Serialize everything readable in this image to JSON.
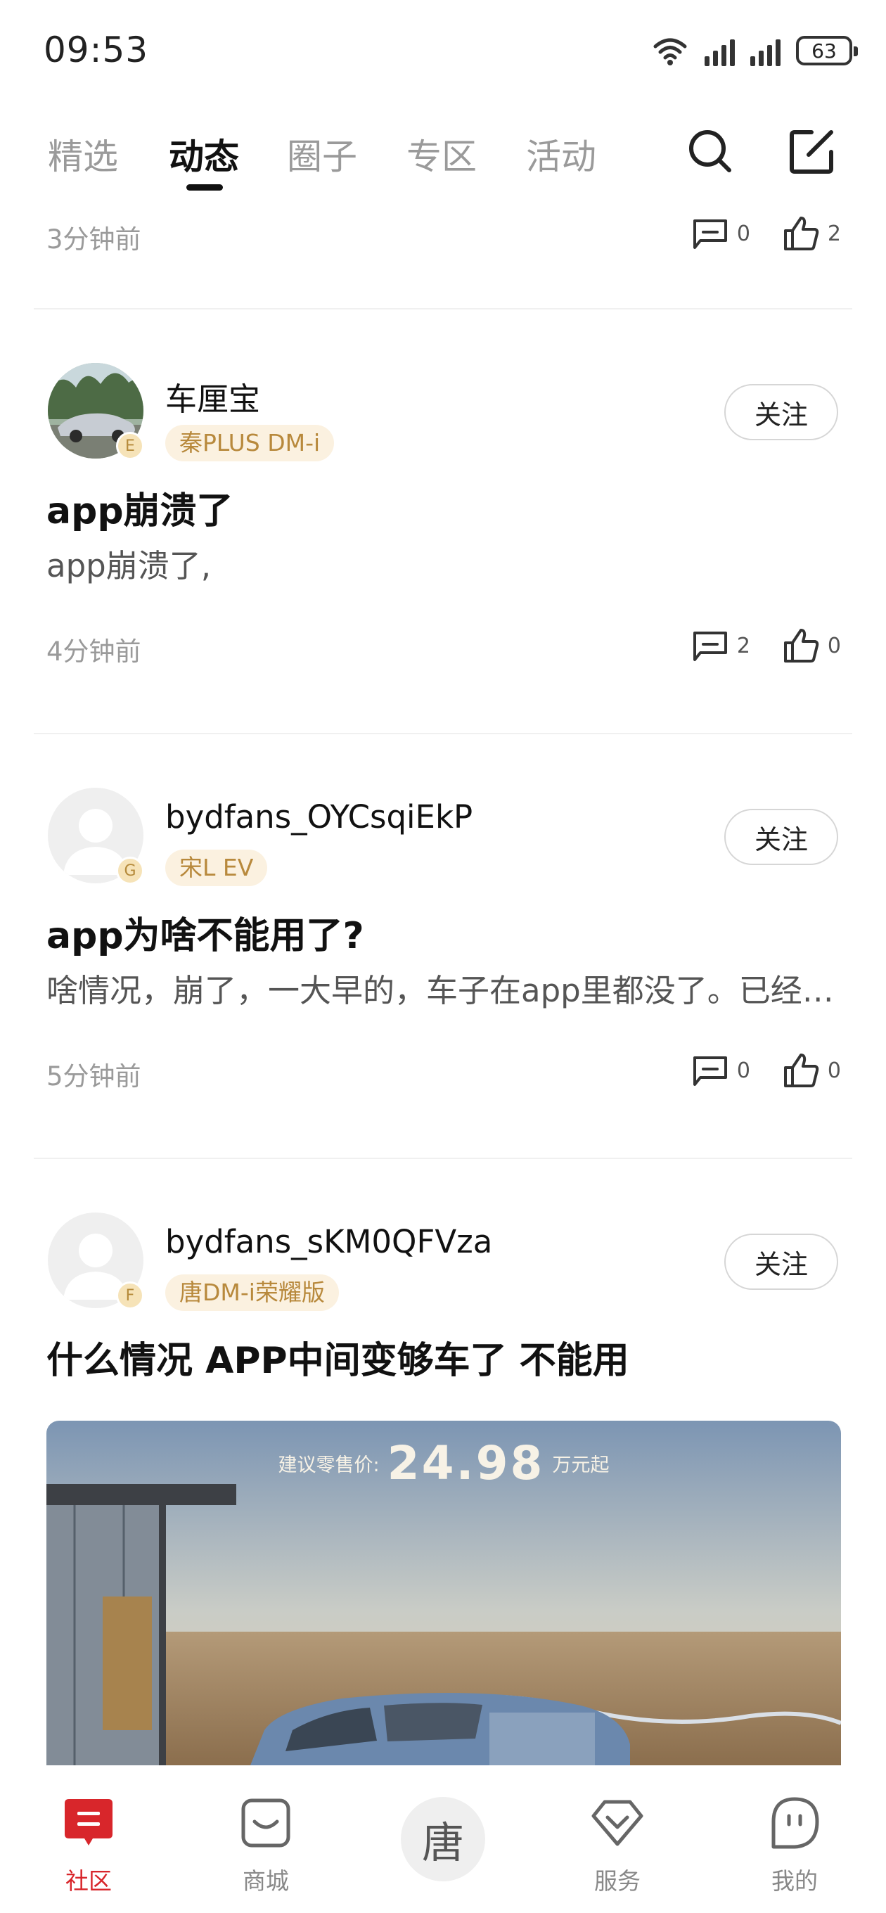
{
  "status_bar": {
    "time": "09:53",
    "battery": "63"
  },
  "tabs": [
    {
      "label": "精选",
      "active": false
    },
    {
      "label": "动态",
      "active": true
    },
    {
      "label": "圈子",
      "active": false
    },
    {
      "label": "专区",
      "active": false
    },
    {
      "label": "活动",
      "active": false
    }
  ],
  "top_actions": {
    "search_icon": "search-icon",
    "compose_icon": "edit-icon"
  },
  "previous_post_meta": {
    "time": "3分钟前",
    "comments": "0",
    "likes": "2"
  },
  "posts": [
    {
      "username": "车厘宝",
      "level": "E",
      "car_tag": "秦PLUS DM-i",
      "follow_label": "关注",
      "title": "app崩溃了",
      "body": "app崩溃了,",
      "time": "4分钟前",
      "comments": "2",
      "likes": "0"
    },
    {
      "username": "bydfans_OYCsqiEkP",
      "level": "G",
      "car_tag": "宋L EV",
      "follow_label": "关注",
      "title": "app为啥不能用了?",
      "body": "啥情况，崩了，一大早的，车子在app里都没了。已经连续好几天了，还是没有恢复正常使用",
      "time": "5分钟前",
      "comments": "0",
      "likes": "0"
    },
    {
      "username": "bydfans_sKM0QFVza",
      "level": "F",
      "car_tag": "唐DM-i荣耀版",
      "follow_label": "关注",
      "title": "什么情况  APP中间变够车了  不能用",
      "image": {
        "price_label": "建议零售价:",
        "price_value": "24.98",
        "price_unit": "万元起"
      }
    }
  ],
  "bottom_nav": {
    "items": [
      {
        "label": "社区",
        "icon": "community-icon",
        "active": true
      },
      {
        "label": "商城",
        "icon": "mall-bag-icon",
        "active": false
      },
      {
        "label": "服务",
        "icon": "service-diamond-icon",
        "active": false
      },
      {
        "label": "我的",
        "icon": "profile-face-icon",
        "active": false
      }
    ],
    "center_label": "唐"
  },
  "colors": {
    "accent": "#d8262b",
    "tag_bg": "#fbf1e0",
    "tag_text": "#b8893c",
    "muted": "#9a9a9a"
  }
}
